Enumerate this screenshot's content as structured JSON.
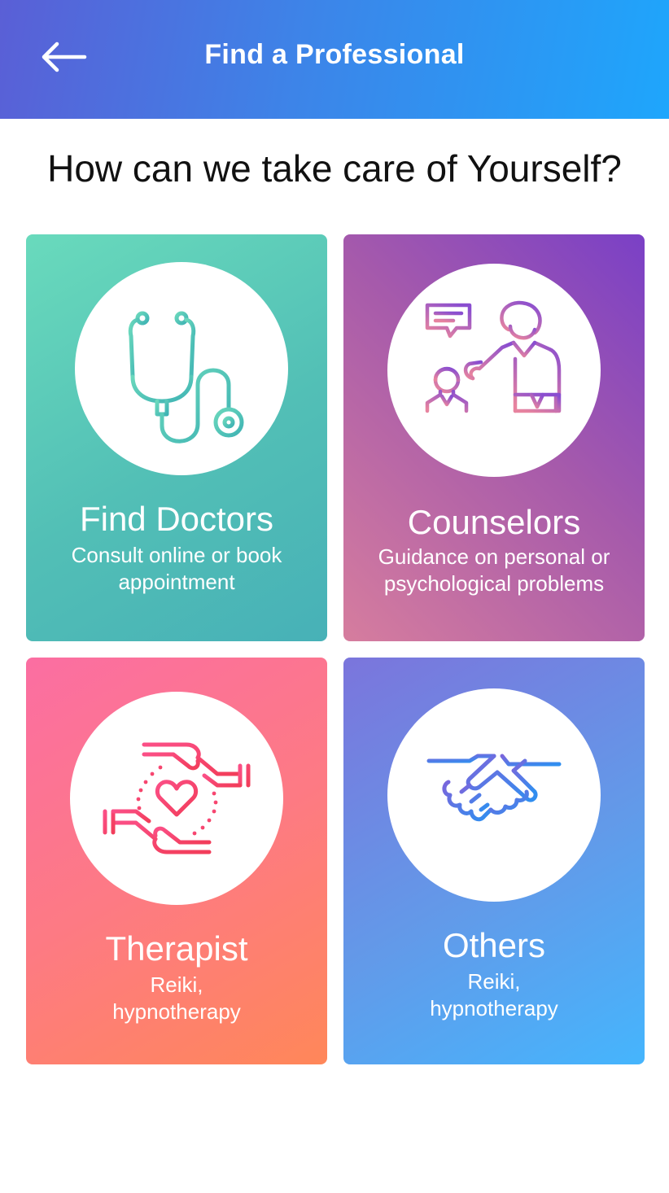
{
  "header": {
    "title": "Find a Professional",
    "back_icon": "arrow-left-icon",
    "gradient": [
      "#5a5fd6",
      "#1ea6fc"
    ]
  },
  "main": {
    "headline": "How can we take care of Yourself?",
    "cards": [
      {
        "title": "Find Doctors",
        "subtitle": "Consult online or book appointment",
        "icon": "stethoscope-icon",
        "colors": [
          "#69dabc",
          "#47b1b7"
        ]
      },
      {
        "title": "Counselors",
        "subtitle": "Guidance on personal or psychological problems",
        "icon": "counselor-icon",
        "colors": [
          "#7a40c6",
          "#d67d9e"
        ]
      },
      {
        "title": "Therapist",
        "subtitle": "Reiki, hypnotherapy",
        "icon": "caring-hands-heart-icon",
        "colors": [
          "#fb6ea2",
          "#ff8759"
        ]
      },
      {
        "title": "Others",
        "subtitle": "Reiki, hypnotherapy",
        "icon": "handshake-icon",
        "colors": [
          "#7b75dc",
          "#45b5fd"
        ]
      }
    ]
  }
}
